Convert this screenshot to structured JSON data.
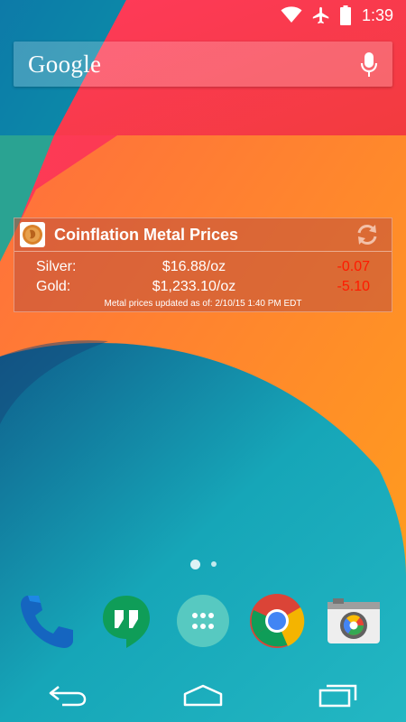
{
  "status_bar": {
    "time": "1:39",
    "icons": [
      "wifi-icon",
      "airplane-mode-icon",
      "battery-icon"
    ]
  },
  "search": {
    "logo_text": "Google",
    "mic_icon": "microphone-icon"
  },
  "widget": {
    "title": "Coinflation Metal Prices",
    "icon": "coin-icon",
    "refresh_icon": "refresh-icon",
    "rows": [
      {
        "label": "Silver:",
        "price": "$16.88/oz",
        "change": "-0.07"
      },
      {
        "label": "Gold:",
        "price": "$1,233.10/oz",
        "change": "-5.10"
      }
    ],
    "updated": "Metal prices updated as of: 2/10/15 1:40 PM EDT",
    "change_color": "#ff1a00"
  },
  "page_indicator": {
    "pages": 2,
    "current": 1
  },
  "dock": {
    "apps": [
      {
        "name": "Phone",
        "icon": "phone-icon"
      },
      {
        "name": "Hangouts",
        "icon": "hangouts-icon"
      },
      {
        "name": "Apps",
        "icon": "app-drawer-icon"
      },
      {
        "name": "Chrome",
        "icon": "chrome-icon"
      },
      {
        "name": "Camera",
        "icon": "camera-icon"
      }
    ]
  },
  "nav_bar": {
    "buttons": [
      "back-icon",
      "home-icon",
      "recents-icon"
    ]
  }
}
